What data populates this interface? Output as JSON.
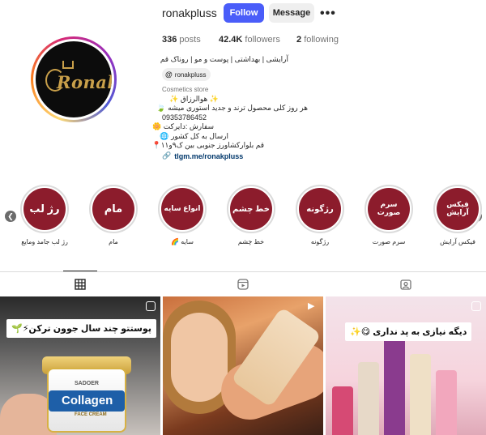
{
  "profile": {
    "username": "ronakpluss",
    "follow_label": "Follow",
    "message_label": "Message",
    "more_label": "•••",
    "logo_text": "Ronak",
    "stats": {
      "posts_count": "336",
      "posts_label": "posts",
      "followers_count": "42.4K",
      "followers_label": "followers",
      "following_count": "2",
      "following_label": "following"
    },
    "bio_title": "آرایشی | بهداشتی | پوست و مو | روناک قم",
    "threads_handle": "ronakpluss",
    "category": "Cosmetics store",
    "bio_lines": [
      "✨ هوالرزاق ✨",
      "هر روز کلی محصول ترند و جدید استوری میشه 🍃",
      "09353786452",
      "سفارش :دایرکت 🌼",
      "ارسال به کل کشور 🌐",
      "قم بلوارکشاورز جنوبی بین ک۹و۱۱📍"
    ],
    "link": "tlgm.me/ronakpluss"
  },
  "highlights": [
    {
      "title": "رژ لب",
      "label": "رژ لب جامد ومایع"
    },
    {
      "title": "مام",
      "label": "مام"
    },
    {
      "title": "انواع سایه",
      "label": "سایه 🌈"
    },
    {
      "title": "خط چشم",
      "label": "خط چشم"
    },
    {
      "title": "رژگونه",
      "label": "رژگونه"
    },
    {
      "title": "سرم صورت",
      "label": "سرم صورت"
    },
    {
      "title": "فیکس آرایش",
      "label": "فیکس آرایش"
    }
  ],
  "tabs": {
    "posts_icon": "grid-icon",
    "reels_icon": "reels-icon",
    "tagged_icon": "tagged-icon"
  },
  "posts": [
    {
      "caption": "پوستتو چند سال جوون ترکن⚡🌱",
      "brand": "SADOER",
      "product": "Collagen",
      "sub": "FACE CREAM"
    },
    {
      "caption": ""
    },
    {
      "caption": "دیگه نیازی به پد نداری 😋✨"
    }
  ],
  "colors": {
    "follow_button": "#4a5df9",
    "highlight_fill": "#8c1c2c",
    "link": "#00376b"
  }
}
